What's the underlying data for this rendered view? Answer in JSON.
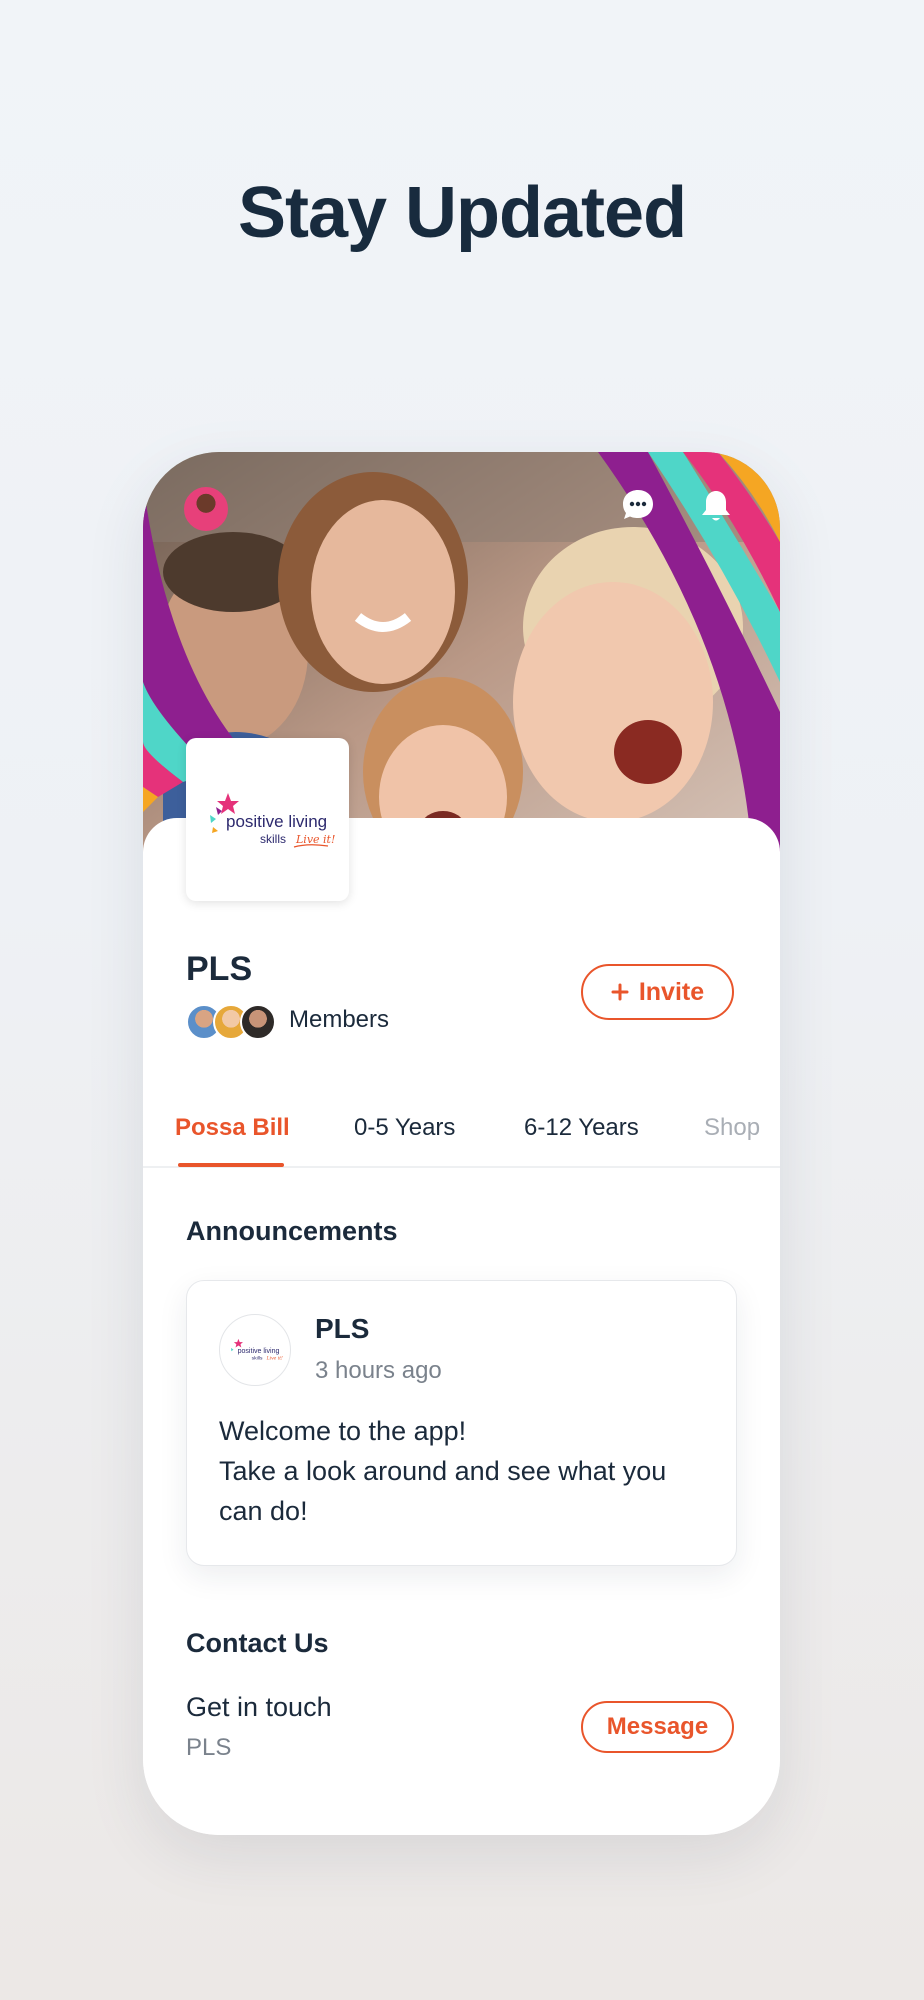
{
  "headline": "Stay Updated",
  "group": {
    "name": "PLS",
    "members_label": "Members",
    "invite_label": "Invite",
    "logo_text": "positive living",
    "logo_subtext": "skills",
    "logo_script": "Live it!"
  },
  "tabs": [
    "Possa Bill",
    "0-5 Years",
    "6-12 Years",
    "Shop"
  ],
  "announcements": {
    "title": "Announcements",
    "post": {
      "author": "PLS",
      "time": "3 hours ago",
      "body_lines": [
        "Welcome to the app!",
        "Take a look around and see what you",
        "can do!"
      ]
    }
  },
  "contact": {
    "title": "Contact Us",
    "line": "Get in touch",
    "sub": "PLS",
    "message_label": "Message"
  },
  "colors": {
    "accent": "#e9552b",
    "text": "#1b2a3b",
    "stripe_purple": "#8e1f8f",
    "stripe_teal": "#4fd6c8",
    "stripe_pink": "#e5327a",
    "stripe_orange": "#f5a623"
  },
  "icons": {
    "chat": "chat-bubble-icon",
    "bell": "bell-icon",
    "plus": "plus-icon"
  }
}
